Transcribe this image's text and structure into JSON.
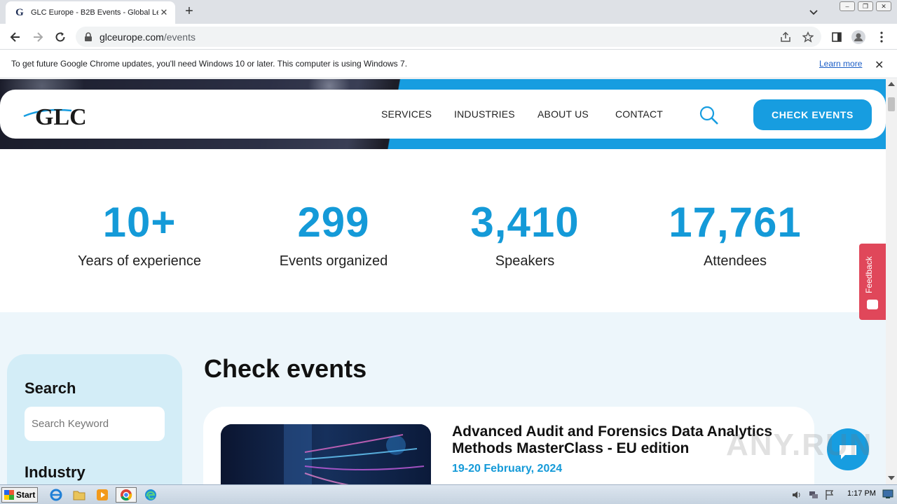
{
  "browser": {
    "tab_title": "GLC Europe - B2B Events - Global Le",
    "url_domain": "glceurope.com",
    "url_path": "/events"
  },
  "infobar": {
    "message": "To get future Google Chrome updates, you'll need Windows 10 or later. This computer is using Windows 7.",
    "link": "Learn more"
  },
  "site": {
    "logo": "GLC",
    "nav": [
      "SERVICES",
      "INDUSTRIES",
      "ABOUT US",
      "CONTACT"
    ],
    "cta": "CHECK EVENTS"
  },
  "stats": [
    {
      "value": "10+",
      "label": "Years of experience"
    },
    {
      "value": "299",
      "label": "Events organized"
    },
    {
      "value": "3,410",
      "label": "Speakers"
    },
    {
      "value": "17,761",
      "label": "Attendees"
    }
  ],
  "sidebar": {
    "search_title": "Search",
    "search_placeholder": "Search Keyword",
    "industry_title": "Industry"
  },
  "events": {
    "heading": "Check events",
    "items": [
      {
        "title": "Advanced Audit and Forensics Data Analytics Methods MasterClass - EU edition",
        "date": "19-20 February, 2024"
      }
    ]
  },
  "feedback": "Feedback",
  "watermark": "ANY.RUN",
  "taskbar": {
    "start": "Start",
    "time": "1:17 PM"
  },
  "colors": {
    "accent": "#179de0",
    "stat_blue": "#149ad8",
    "feedback_red": "#e0475a"
  }
}
